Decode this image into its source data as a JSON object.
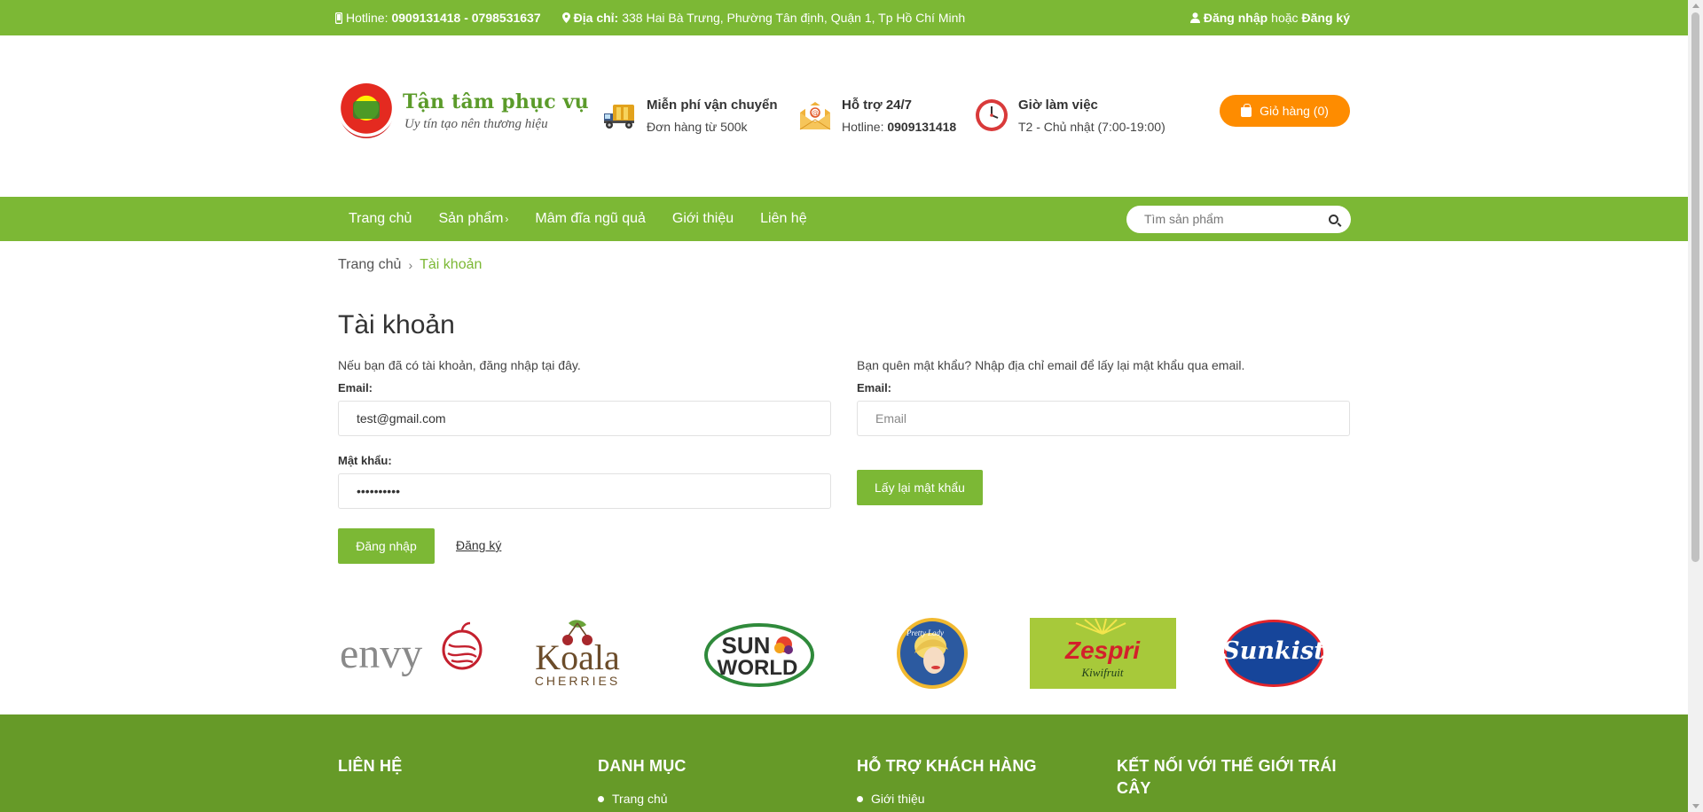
{
  "topbar": {
    "hotline_label": "Hotline:",
    "hotline_value": "0909131418 - 0798531637",
    "address_label": "Địa chỉ:",
    "address_value": "338 Hai Bà Trưng, Phường Tân định, Quận 1, Tp Hồ Chí Minh",
    "login": "Đăng nhập",
    "or": "hoặc",
    "register": "Đăng ký"
  },
  "header": {
    "slogan": "Tận tâm phục vụ",
    "tagline": "Uy tín tạo nên thương hiệu",
    "features": [
      {
        "title": "Miễn phí vận chuyển",
        "sub": "Đơn hàng từ 500k",
        "icon": "truck-icon"
      },
      {
        "title": "Hỗ trợ 24/7",
        "sub_label": "Hotline:",
        "sub_value": "0909131418",
        "icon": "mail-icon"
      },
      {
        "title": "Giờ làm việc",
        "sub": "T2 - Chủ nhật (7:00-19:00)",
        "icon": "clock-icon"
      }
    ],
    "cart": "Giỏ hàng (0)"
  },
  "nav": {
    "items": [
      "Trang chủ",
      "Sản phẩm",
      "Mâm đĩa ngũ quả",
      "Giới thiệu",
      "Liên hệ"
    ],
    "search_placeholder": "Tìm sản phẩm"
  },
  "breadcrumb": {
    "home": "Trang chủ",
    "current": "Tài khoản"
  },
  "account": {
    "title": "Tài khoản",
    "login_desc": "Nếu bạn đã có tài khoản, đăng nhập tại đây.",
    "email_label": "Email:",
    "email_value": "test@gmail.com",
    "password_label": "Mật khẩu:",
    "password_value": "••••••••••",
    "login_button": "Đăng nhập",
    "register_link": "Đăng ký",
    "forgot_desc": "Bạn quên mật khẩu? Nhập địa chỉ email để lấy lại mật khẩu qua email.",
    "forgot_email_label": "Email:",
    "forgot_email_placeholder": "Email",
    "reset_button": "Lấy lại mật khẩu"
  },
  "brands": [
    "envy",
    "Koala",
    "CHERRIES",
    "SUN",
    "WORLD",
    "Pretty Lady",
    "Zespri",
    "Kiwifruit",
    "Sunkist"
  ],
  "footer": {
    "columns": [
      {
        "heading": "LIÊN HỆ",
        "items": []
      },
      {
        "heading": "DANH MỤC",
        "items": [
          "Trang chủ"
        ]
      },
      {
        "heading": "HỖ TRỢ KHÁCH HÀNG",
        "items": [
          "Giới thiệu"
        ]
      },
      {
        "heading": "KẾT NỐI VỚI THẾ GIỚI TRÁI CÂY",
        "items": []
      }
    ]
  },
  "colors": {
    "brand_green": "#7cb835",
    "footer_green": "#669a28",
    "cart_orange": "#fe8c00"
  }
}
